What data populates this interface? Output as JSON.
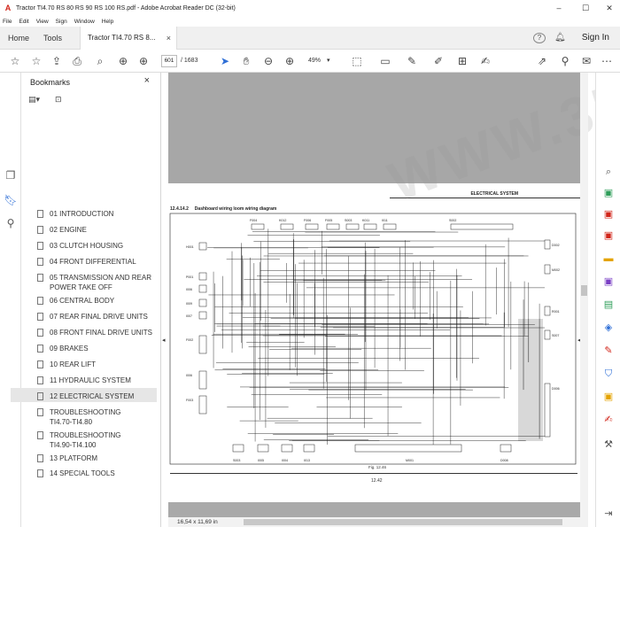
{
  "window": {
    "title": "Tractor TI4.70 RS 80 RS 90 RS 100 RS.pdf - Adobe Acrobat Reader DC (32-bit)",
    "minimize": "–",
    "maximize": "☐",
    "close": "✕"
  },
  "menu": [
    "File",
    "Edit",
    "View",
    "Sign",
    "Window",
    "Help"
  ],
  "tabs": {
    "home": "Home",
    "tools": "Tools",
    "document": "Tractor TI4.70 RS 8...",
    "document_close": "×",
    "sign_in": "Sign In"
  },
  "toolbar": {
    "current_page": "601",
    "page_total": "/ 1683",
    "zoom": "49%"
  },
  "bookmarks": {
    "title": "Bookmarks",
    "close": "×",
    "items": [
      {
        "label": "01 INTRODUCTION"
      },
      {
        "label": "02 ENGINE"
      },
      {
        "label": "03 CLUTCH HOUSING"
      },
      {
        "label": "04 FRONT DIFFERENTIAL"
      },
      {
        "label": "05 TRANSMISSION AND REAR",
        "label2": "POWER TAKE OFF"
      },
      {
        "label": "06 CENTRAL BODY"
      },
      {
        "label": "07 REAR FINAL DRIVE UNITS"
      },
      {
        "label": "08 FRONT FINAL DRIVE UNITS"
      },
      {
        "label": "09 BRAKES"
      },
      {
        "label": "10 REAR LIFT"
      },
      {
        "label": "11 HYDRAULIC SYSTEM"
      },
      {
        "label": "12 ELECTRICAL SYSTEM",
        "selected": true
      },
      {
        "label": "TROUBLESHOOTING",
        "label2": "TI4.70-TI4.80"
      },
      {
        "label": "TROUBLESHOOTING",
        "label2": "TI4.90-TI4.100"
      },
      {
        "label": "13 PLATFORM"
      },
      {
        "label": "14 SPECIAL TOOLS"
      }
    ]
  },
  "document": {
    "section_header": "ELECTRICAL SYSTEM",
    "figure_title": "12.4.14.2     Dashboard wiring loom wiring diagram",
    "figure_caption": "Fig. 12.46",
    "page_number": "12.42",
    "watermark": "WWW.3500PO.COM",
    "page_size": "16,54 x 11,69 in",
    "top_labels": [
      "F004",
      "K012",
      "F006",
      "F005",
      "S003",
      "K011",
      "I011",
      "S002"
    ],
    "left_labels": [
      "H001",
      "P001",
      "I006",
      "I009",
      "I007",
      "F002",
      "I006",
      "F003"
    ],
    "right_labels": [
      "D002",
      "M002",
      "R001",
      "S007",
      "D006"
    ],
    "bottom_labels": [
      "S003",
      "I005",
      "I004",
      "I013",
      "M001",
      "D008"
    ]
  },
  "colors": {
    "accent_red": "#d1251a",
    "rail_blue": "#2f6fd6"
  }
}
